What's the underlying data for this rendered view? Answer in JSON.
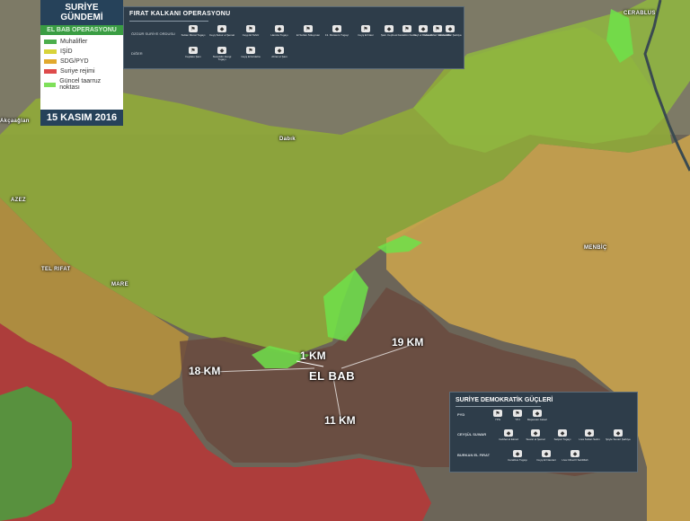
{
  "towns": {
    "cerablus": "CERABLUS",
    "akcakale": "Akçaağlan",
    "azez": "AZEZ",
    "telrifat": "TEL RIFAT",
    "mare": "MARE",
    "dabik": "Dabık",
    "menbic": "MENBİÇ",
    "elbab": "EL BAB"
  },
  "distances": {
    "km1": "1 KM",
    "km18": "18 KM",
    "km19": "19 KM",
    "km11": "11 KM"
  },
  "legend": {
    "title": "SURİYE GÜNDEMİ",
    "subtitle": "EL BAB OPERASYONU",
    "items": [
      {
        "label": "Muhalifler",
        "color": "#4cae4c"
      },
      {
        "label": "IŞİD",
        "color": "#d8d33a"
      },
      {
        "label": "SDG/PYD",
        "color": "#e1a92e"
      },
      {
        "label": "Suriye rejimi",
        "color": "#de4b4b"
      },
      {
        "label": "Güncel taarruz noktası",
        "color": "#7fe05a"
      }
    ],
    "date": "15 KASIM 2016"
  },
  "operation": {
    "title": "FIRAT KALKANI OPERASYONU",
    "row1": "ÖZGÜR SURİYE ORDUSU",
    "row2": "DİĞER",
    "row1_groups": [
      "Sultan Murat Tugayı",
      "Ceyş Sukur el Şemal",
      "Ceyş El Tahrir",
      "Hamza Tugayı",
      "El Sultan Süleyman",
      "13. Mutasım Tugayı",
      "Ceyş El Nasr",
      "Şam Cephesi",
      "Fastakim Kema",
      "Feyl el Rahman",
      "Liva Ahfad Salahaddin",
      "Ahrar Elfar Şarkiya"
    ],
    "row2_groups": [
      "Feylaku Şam",
      "Nureddin Zengi Tugayı",
      "Ceyş El Ezdeha",
      "Ahrar el Şam"
    ]
  },
  "sdg": {
    "title": "SURİYE DEMOKRATİK GÜÇLERİ",
    "pyd": "PYD",
    "pyd_groups": [
      "YPG",
      "YPJ",
      "Mejeesarı Askeri"
    ],
    "ceysul": "CEYŞÜL SUWAR",
    "ceysul_groups": [
      "Cebhet el Ekrad",
      "Suwar el Şemal",
      "Selçuk Tugayı",
      "Liva Sultan Selim",
      "Şöyle Suvari Şarkiye"
    ],
    "burkan": "BURKAN EL FIRAT",
    "burkan_groups": [
      "Cerablus Tugayı",
      "Ceyş El Nasrani",
      "Liva Cihad fi Sebilillah"
    ]
  },
  "colors": {
    "rebels": "#4cae4c",
    "isis": "#b8b238",
    "sdg": "#d9a33a",
    "regime": "#c83a3a",
    "attack": "#6ee24a",
    "panel": "#2e3d4a"
  }
}
